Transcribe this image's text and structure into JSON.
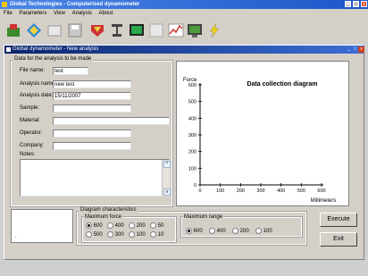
{
  "window": {
    "title": "Global Technologies - Computerised dynamometer"
  },
  "menu": [
    "File",
    "Parameters",
    "View",
    "Analysis",
    "About"
  ],
  "toolbar": [
    "open-icon",
    "analysis-icon",
    "folder-icon",
    "save-icon",
    "bookmark-icon",
    "press-icon",
    "monitor-icon",
    "grid-icon",
    "chart-icon",
    "display-icon",
    "lightning-icon"
  ],
  "child": {
    "title": "Global dynamometer - New analysis"
  },
  "data_group": {
    "title": "Data for the analysis to be made",
    "file_name_label": "File name:",
    "file_name_value": "test",
    "analysis_name_label": "Analysis name:",
    "analysis_name_value": "new test",
    "analysis_date_label": "Analysis date:",
    "analysis_date_value": "15/11/2007",
    "sample_label": "Sample:",
    "material_label": "Material:",
    "operator_label": "Operator:",
    "company_label": "Company:",
    "notes_label": "Notes:"
  },
  "chart_data": {
    "type": "line",
    "title": "Data collection diagram",
    "ylabel": "Force",
    "xlabel": "Millimeters",
    "xlim": [
      0,
      600
    ],
    "ylim": [
      0,
      600
    ],
    "x_ticks": [
      "0",
      "100",
      "200",
      "300",
      "400",
      "500",
      "600"
    ],
    "y_ticks": [
      "0",
      "100",
      "200",
      "300",
      "400",
      "500",
      "600"
    ],
    "series": []
  },
  "diagram": {
    "title": "Diagram characteristics",
    "max_force_title": "Maximum force",
    "force_options": [
      "600",
      "400",
      "200",
      "50",
      "500",
      "300",
      "100",
      "10"
    ],
    "force_selected": "600",
    "max_range_title": "Maximum range",
    "range_options": [
      "600",
      "400",
      "200",
      "100"
    ],
    "range_selected": "600"
  },
  "preview_text": ".",
  "buttons": {
    "execute": "Execute",
    "exit": "Exit"
  },
  "colors": {
    "titlebar": "#1e56c8",
    "child_titlebar": "#0a246a"
  }
}
